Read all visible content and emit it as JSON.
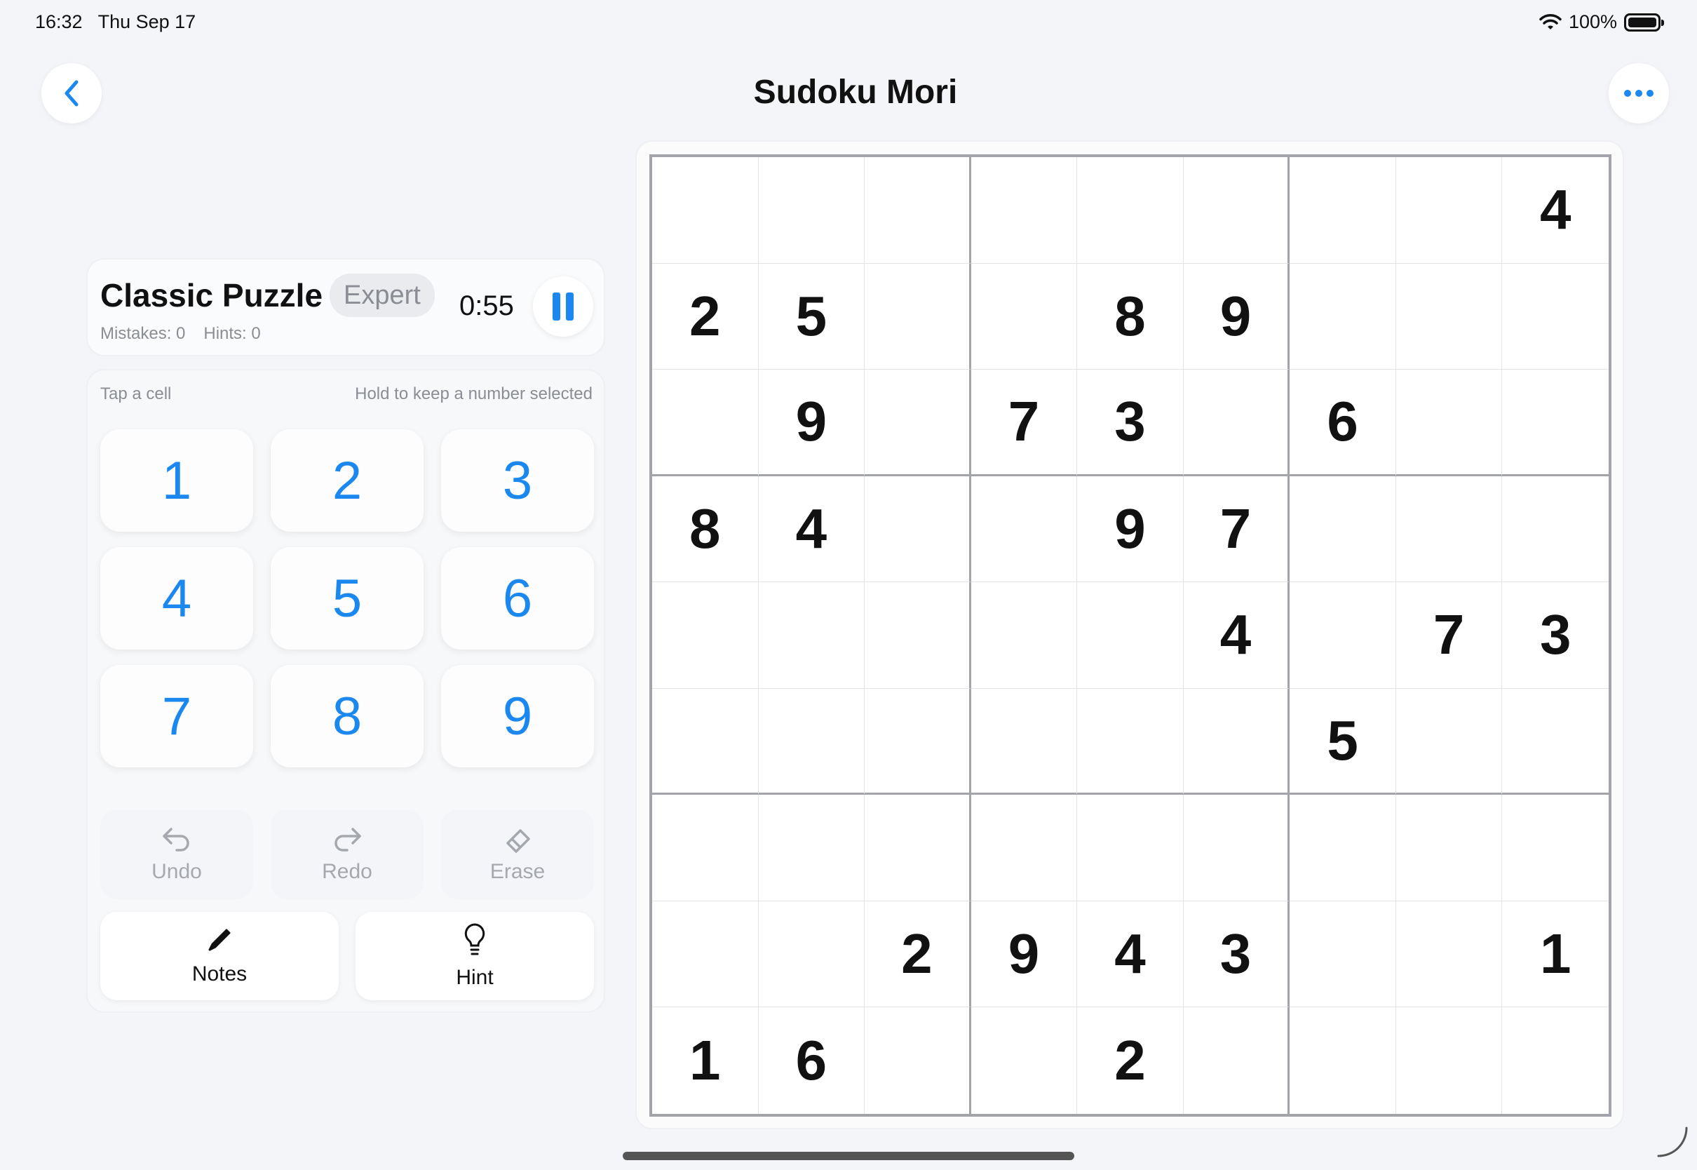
{
  "status_bar": {
    "time": "16:32",
    "date": "Thu Sep 17",
    "battery": "100%"
  },
  "nav": {
    "title": "Sudoku Mori"
  },
  "game_info": {
    "title": "Classic Puzzle",
    "difficulty": "Expert",
    "mistakes": "Mistakes: 0",
    "hints": "Hints: 0",
    "timer": "0:55"
  },
  "pad": {
    "instruction_left": "Tap a cell",
    "instruction_right": "Hold to keep a number selected",
    "numbers": [
      "1",
      "2",
      "3",
      "4",
      "5",
      "6",
      "7",
      "8",
      "9"
    ],
    "undo_label": "Undo",
    "redo_label": "Redo",
    "erase_label": "Erase",
    "notes_label": "Notes",
    "hint_label": "Hint"
  },
  "colors": {
    "accent": "#1a88ee",
    "background": "#f4f5f8",
    "disabled": "#a5a8ae"
  },
  "icons": [
    "chevron-left-icon",
    "ellipsis-icon",
    "pause-icon",
    "undo-icon",
    "redo-icon",
    "eraser-icon",
    "pencil-icon",
    "lightbulb-icon",
    "wifi-icon",
    "battery-icon"
  ],
  "board": [
    [
      "",
      "",
      "",
      "",
      "",
      "",
      "",
      "",
      "4"
    ],
    [
      "2",
      "5",
      "",
      "",
      "8",
      "9",
      "",
      "",
      ""
    ],
    [
      "",
      "9",
      "",
      "7",
      "3",
      "",
      "6",
      "",
      ""
    ],
    [
      "8",
      "4",
      "",
      "",
      "9",
      "7",
      "",
      "",
      ""
    ],
    [
      "",
      "",
      "",
      "",
      "",
      "4",
      "",
      "7",
      "3"
    ],
    [
      "",
      "",
      "",
      "",
      "",
      "",
      "5",
      "",
      ""
    ],
    [
      "",
      "",
      "",
      "",
      "",
      "",
      "",
      "",
      ""
    ],
    [
      "",
      "",
      "2",
      "9",
      "4",
      "3",
      "",
      "",
      "1"
    ],
    [
      "1",
      "6",
      "",
      "",
      "2",
      "",
      "",
      "",
      ""
    ]
  ]
}
